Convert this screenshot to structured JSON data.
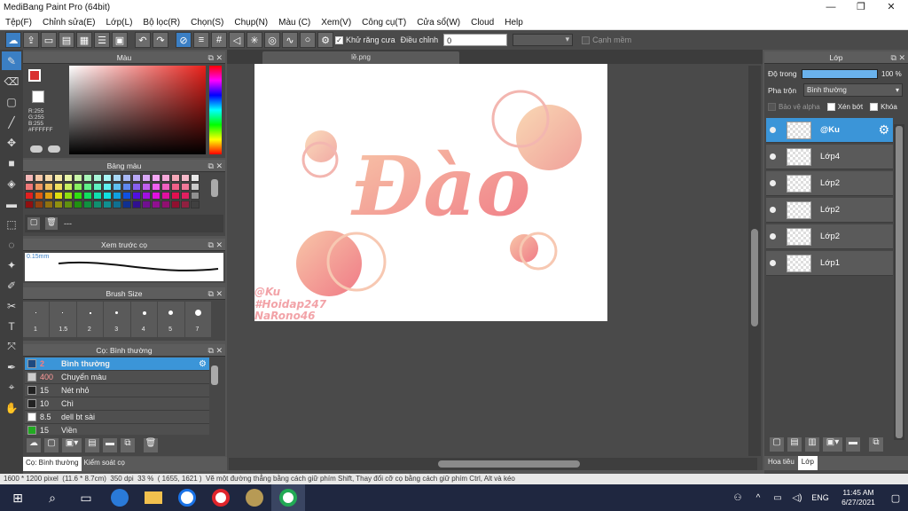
{
  "window": {
    "title": "MediBang Paint Pro (64bit)",
    "min": "—",
    "max": "❐",
    "close": "✕"
  },
  "menu": [
    "Tệp(F)",
    "Chỉnh sửa(E)",
    "Lớp(L)",
    "Bộ lọc(R)",
    "Chọn(S)",
    "Chụp(N)",
    "Màu (C)",
    "Xem(V)",
    "Công cụ(T)",
    "Cửa sổ(W)",
    "Cloud",
    "Help"
  ],
  "toolbar": {
    "antialias_label": "Khử răng cưa",
    "antialias_checked": true,
    "correction_label": "Điều chỉnh",
    "correction_value": "0",
    "edge_label": "Cạnh mềm"
  },
  "color_panel": {
    "title": "Màu",
    "rgb": [
      "R:255",
      "G:255",
      "B:255"
    ],
    "hex": "#FFFFFF"
  },
  "palette_panel": {
    "title": "Bảng màu",
    "footer": "---"
  },
  "preview_panel": {
    "title": "Xem trước cọ",
    "size": "0.15mm"
  },
  "brushsize_panel": {
    "title": "Brush Size",
    "sizes": [
      "1",
      "1.5",
      "2",
      "3",
      "4",
      "5",
      "7"
    ]
  },
  "brush_panel": {
    "title": "Cọ: Bình thường",
    "items": [
      {
        "size": "2",
        "name": "Bình thường",
        "color": "#1e4a80",
        "selected": true
      },
      {
        "size": "400",
        "name": "Chuyển màu",
        "color": "#cccccc",
        "selected": false
      },
      {
        "size": "15",
        "name": "Nét nhỏ",
        "color": "#222222",
        "selected": false
      },
      {
        "size": "10",
        "name": "Chì",
        "color": "#222222",
        "selected": false
      },
      {
        "size": "8.5",
        "name": "dell bt sài",
        "color": "#ffffff",
        "selected": false
      },
      {
        "size": "15",
        "name": "Viền",
        "color": "#22aa22",
        "selected": false
      }
    ],
    "tabs": [
      "Cọ: Bình thường",
      "Kiểm soát cọ"
    ]
  },
  "canvas": {
    "tab_title": "lề.png",
    "artwork_text": "Đào",
    "watermark": [
      "@Ku",
      "#Hoidap247",
      "NaRono46"
    ]
  },
  "layers_panel": {
    "title": "Lớp",
    "opacity_label": "Độ trong",
    "opacity_value": "100 %",
    "opacity_fraction": 1.0,
    "blend_label": "Pha trộn",
    "blend_value": "Bình thường",
    "protect_alpha": "Bảo vệ alpha",
    "clipping": "Xén bớt",
    "lock": "Khóa",
    "layers": [
      {
        "name": "@Ku",
        "selected": true
      },
      {
        "name": "Lớp4",
        "selected": false
      },
      {
        "name": "Lớp2",
        "selected": false
      },
      {
        "name": "Lớp2",
        "selected": false
      },
      {
        "name": "Lớp2",
        "selected": false
      },
      {
        "name": "Lớp1",
        "selected": false
      }
    ],
    "tabs": [
      "Hoa tiêu",
      "Lớp"
    ]
  },
  "status": {
    "size": "1600 * 1200 pixel",
    "physical": "(11.6 * 8.7cm)",
    "dpi": "350 dpi",
    "zoom": "33 %",
    "coords": "( 1655, 1621 )",
    "hint": "Vẽ một đường thẳng bằng cách giữ phím Shift, Thay đổi cỡ cọ bằng cách giữ phím Ctrl, Alt và kéo"
  },
  "taskbar": {
    "lang": "ENG",
    "time": "11:45 AM",
    "date": "6/27/2021"
  },
  "colors": {
    "accent": "#3b95d8",
    "panel": "#474747",
    "taskbar": "#1f2740"
  }
}
